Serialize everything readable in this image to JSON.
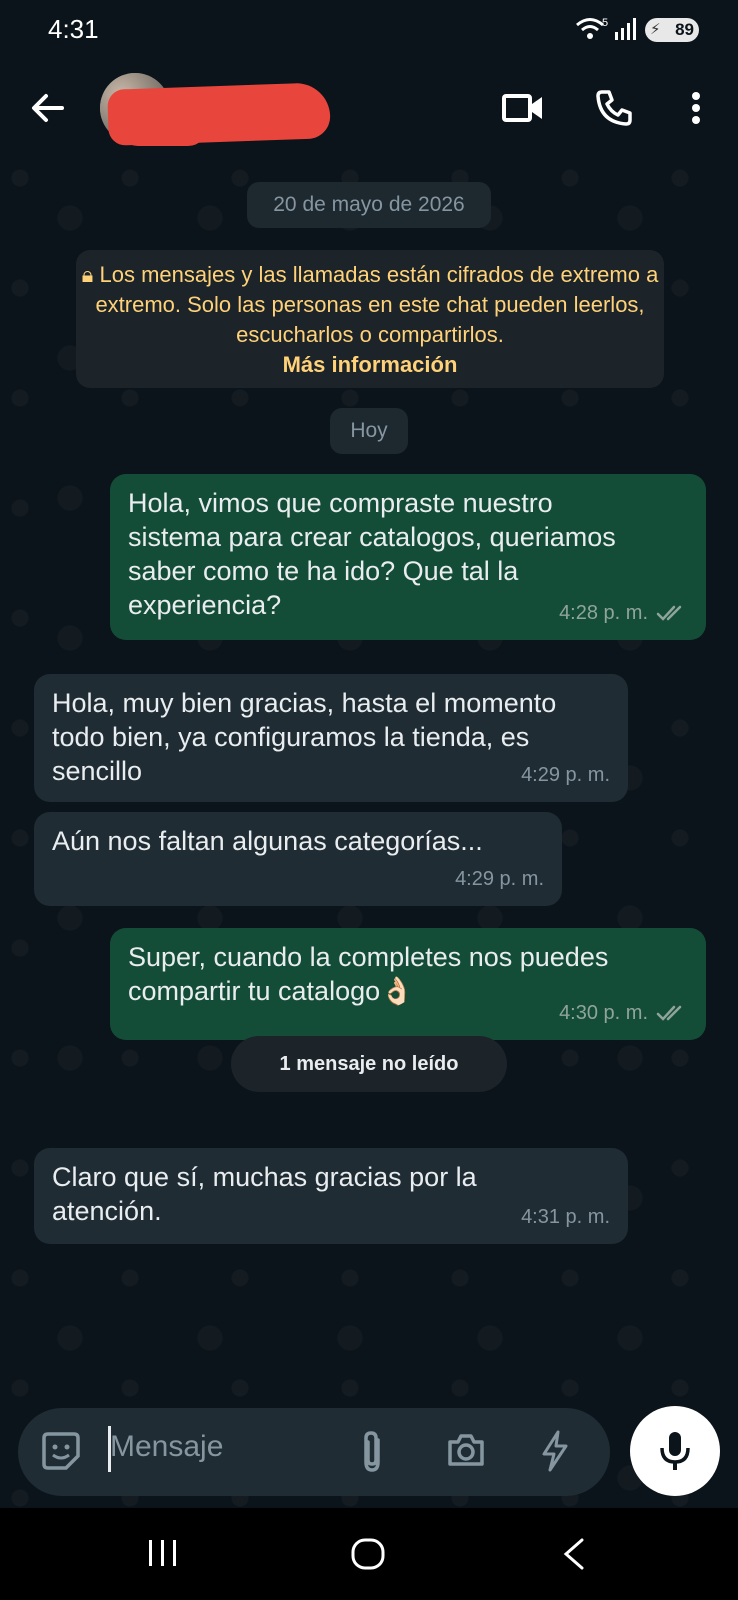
{
  "status_bar": {
    "time": "4:31",
    "wifi_label": "5",
    "battery": "89"
  },
  "header": {
    "contact_name": "",
    "icons": [
      "back-arrow-icon",
      "video-call-icon",
      "phone-icon",
      "more-vert-icon"
    ]
  },
  "chat": {
    "date_chip": "20 de mayo de 2026",
    "encryption_notice": "Los mensajes y las llamadas están cifrados de extremo a extremo. Solo las personas en este chat pueden leerlos, escucharlos o compartirlos.",
    "encryption_more": "Más información",
    "today_chip": "Hoy",
    "messages": [
      {
        "direction": "out",
        "text": "Hola, vimos que compraste nuestro sistema para crear catalogos, queriamos saber como te ha ido? Que tal la experiencia?",
        "time": "4:28 p. m.",
        "status": "read"
      },
      {
        "direction": "in",
        "text": "Hola, muy bien gracias, hasta el momento todo bien, ya configuramos la tienda, es sencillo",
        "time": "4:29 p. m."
      },
      {
        "direction": "in",
        "text": "Aún nos faltan algunas categorías...",
        "time": "4:29 p. m."
      },
      {
        "direction": "out",
        "text": "Super, cuando la completes nos puedes compartir tu catalogo👌🏻",
        "time": "4:30 p. m.",
        "status": "read"
      },
      {
        "direction": "in",
        "text": "Claro que sí, muchas gracias por la atención.",
        "time": "4:31 p. m."
      }
    ],
    "unread_chip": "1 mensaje no leído"
  },
  "composer": {
    "placeholder": "Mensaje",
    "icons": [
      "sticker-icon",
      "attach-icon",
      "camera-icon",
      "bolt-icon",
      "mic-icon"
    ]
  },
  "colors": {
    "background": "#0b141a",
    "outgoing_bubble": "#144d37",
    "incoming_bubble": "#1f2c34",
    "encryption_text": "#ffd279"
  }
}
